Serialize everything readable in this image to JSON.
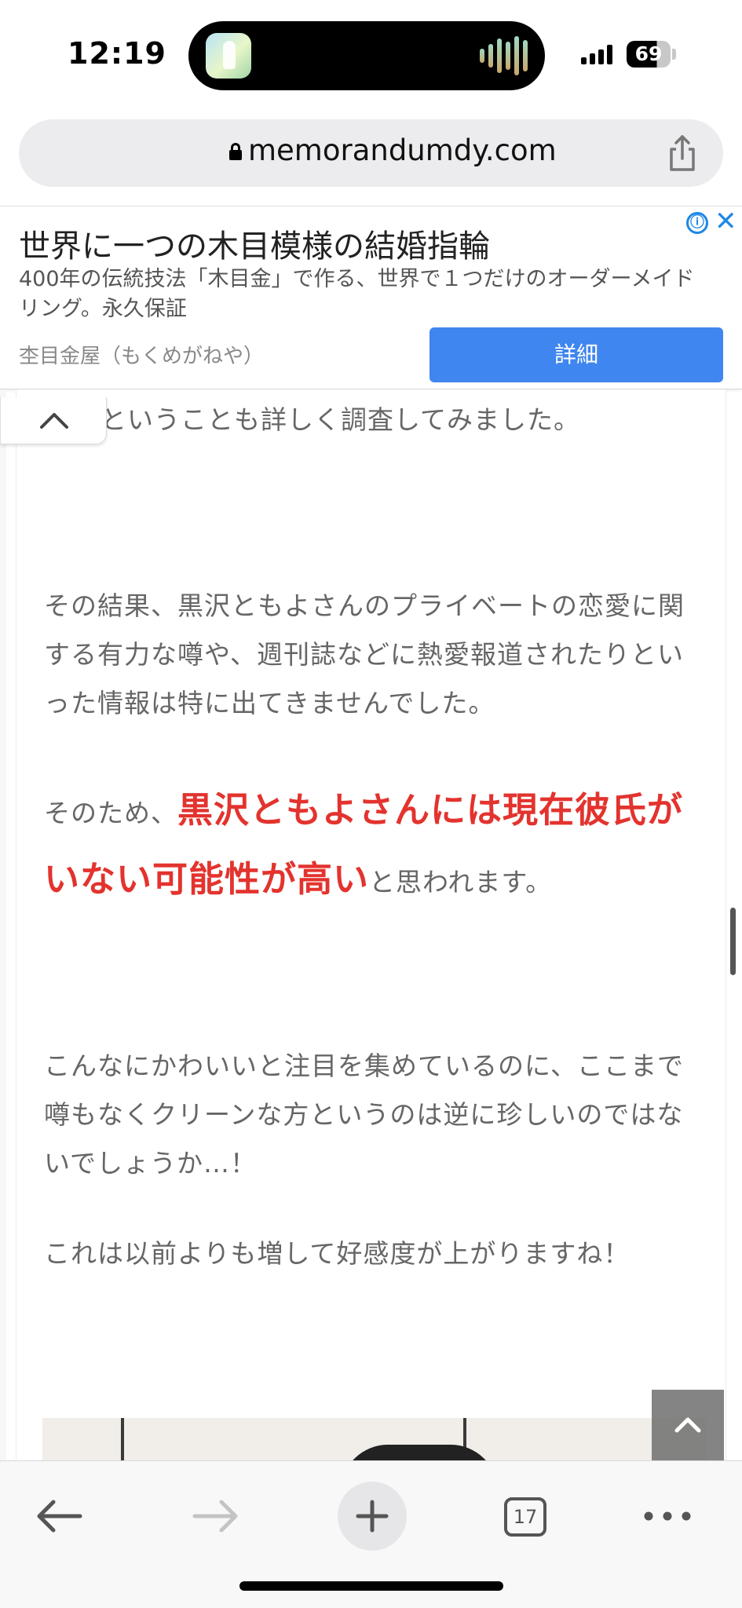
{
  "status_bar": {
    "time": "12:19",
    "battery": "69"
  },
  "browser": {
    "url": "memorandumdy.com",
    "lock_icon": "lock-icon",
    "share_icon": "share-icon"
  },
  "ad": {
    "title": "世界に一つの木目模様の結婚指輪",
    "description": "400年の伝統技法「木目金」で作る、世界で１つだけのオーダーメイドリング。永久保証",
    "advertiser": "杢目金屋（もくめがねや）",
    "button": "詳細",
    "info_icon": "ⓘ",
    "close_icon": "✕",
    "button_color": "#3f86f0"
  },
  "article": {
    "partial_line": "ということも詳しく調査してみました。",
    "para1": "その結果、黒沢ともよさんのプライベートの恋愛に関する有力な噂や、週刊誌などに熱愛報道されたりといった情報は特に出てきませんでした。",
    "para2_prefix": "そのため、",
    "para2_highlight": "黒沢ともよさんには現在彼氏がいない可能性が高い",
    "para2_suffix": "と思われます。",
    "para3": "こんなにかわいいと注目を集めているのに、ここまで噂もなくクリーンな方というのは逆に珍しいのではないでしょうか…！",
    "para4": "これは以前よりも増して好感度が上がりますね！",
    "highlight_color": "#e3332e"
  },
  "toolbar": {
    "tab_count": "17",
    "icons": [
      "back-arrow-icon",
      "forward-arrow-icon",
      "plus-icon",
      "tabs-icon",
      "more-icon"
    ]
  }
}
